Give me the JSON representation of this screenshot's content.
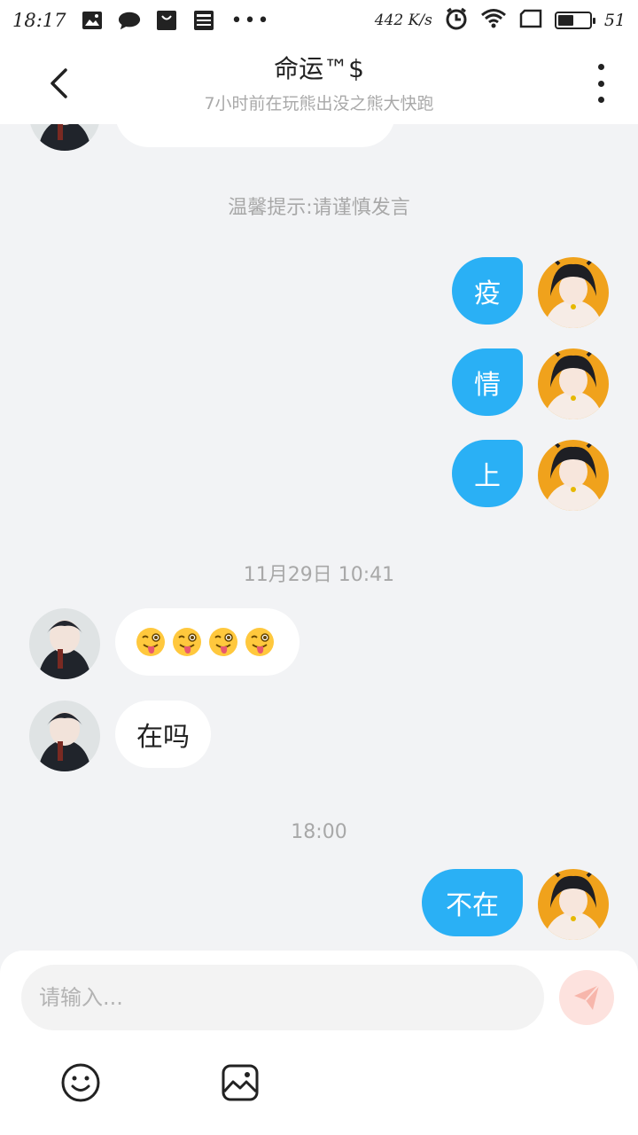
{
  "status_bar": {
    "time": "18:17",
    "icons": [
      "image-icon",
      "chat-icon",
      "bag-icon",
      "news-icon"
    ],
    "dots": "•••",
    "speed": "442 K/s",
    "battery_level": "51",
    "battery_fill": 0.5
  },
  "header": {
    "title": "命运™$",
    "subtitle": "7小时前在玩熊出没之熊大快跑"
  },
  "chat": {
    "tip": "温馨提示:请谨慎发言",
    "outgoing_1": [
      "疫",
      "情",
      "上"
    ],
    "timestamp_1": "11月29日 10:41",
    "incoming_emoji": [
      "😜",
      "😜",
      "😜",
      "😜"
    ],
    "incoming_text": "在吗",
    "timestamp_2": "18:00",
    "outgoing_2": "不在"
  },
  "composer": {
    "placeholder": "请输入...",
    "send_icon": "send-icon",
    "emoji_icon": "emoji-icon",
    "image_icon": "image-picker-icon"
  },
  "colors": {
    "accent": "#2ab0f5",
    "send_disabled": "#fde2de"
  }
}
